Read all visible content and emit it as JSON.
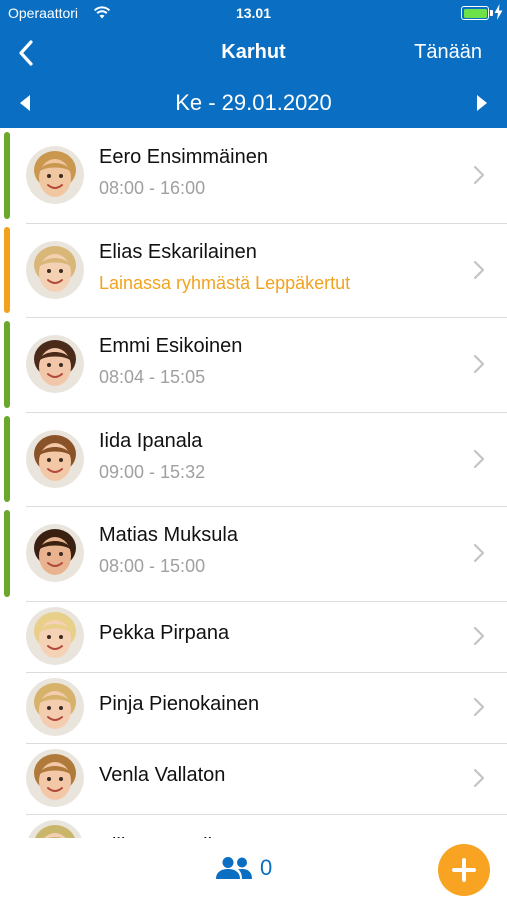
{
  "status_bar": {
    "carrier": "Operaattori",
    "time": "13.01",
    "battery_level": 1.0,
    "battery_color": "#6ee04a"
  },
  "nav": {
    "title": "Karhut",
    "today_label": "Tänään"
  },
  "date_bar": {
    "date": "Ke - 29.01.2020"
  },
  "colors": {
    "header_bg": "#0a6fc2",
    "present": "#6aa82b",
    "loan": "#f3a21f",
    "accent_orange": "#f8a322"
  },
  "children": [
    {
      "name": "Eero Ensimmäinen",
      "detail": "08:00 - 16:00",
      "status": "present",
      "avatar": {
        "hair": "#c9974e",
        "skin": "#f1c7a2"
      }
    },
    {
      "name": "Elias Eskarilainen",
      "detail": "Lainassa ryhmästä Leppäkertut",
      "status": "loan",
      "avatar": {
        "hair": "#d9b778",
        "skin": "#f4d1b3"
      }
    },
    {
      "name": "Emmi Esikoinen",
      "detail": "08:04 - 15:05",
      "status": "present",
      "avatar": {
        "hair": "#4a2a18",
        "skin": "#f2c6a8"
      }
    },
    {
      "name": "Iida Ipanala",
      "detail": "09:00 - 15:32",
      "status": "present",
      "avatar": {
        "hair": "#8a5228",
        "skin": "#f3c8a6"
      }
    },
    {
      "name": "Matias Muksula",
      "detail": "08:00 - 15:00",
      "status": "present",
      "avatar": {
        "hair": "#3a2010",
        "skin": "#e8b38e"
      }
    },
    {
      "name": "Pekka Pirpana",
      "detail": "",
      "status": "none",
      "avatar": {
        "hair": "#e8cf8a",
        "skin": "#f5d2b5"
      }
    },
    {
      "name": "Pinja Pienokainen",
      "detail": "",
      "status": "none",
      "avatar": {
        "hair": "#d7b26a",
        "skin": "#f4cdb0"
      }
    },
    {
      "name": "Venla Vallaton",
      "detail": "",
      "status": "none",
      "avatar": {
        "hair": "#b07a3a",
        "skin": "#f3c8a8"
      }
    },
    {
      "name": "Vilho Vesseli",
      "detail": "",
      "status": "none",
      "avatar": {
        "hair": "#c9b66a",
        "skin": "#f2cfb2"
      }
    }
  ],
  "bottom_bar": {
    "attendance_icon": "people-icon",
    "attendance_count": "0",
    "add_icon": "plus-icon"
  }
}
